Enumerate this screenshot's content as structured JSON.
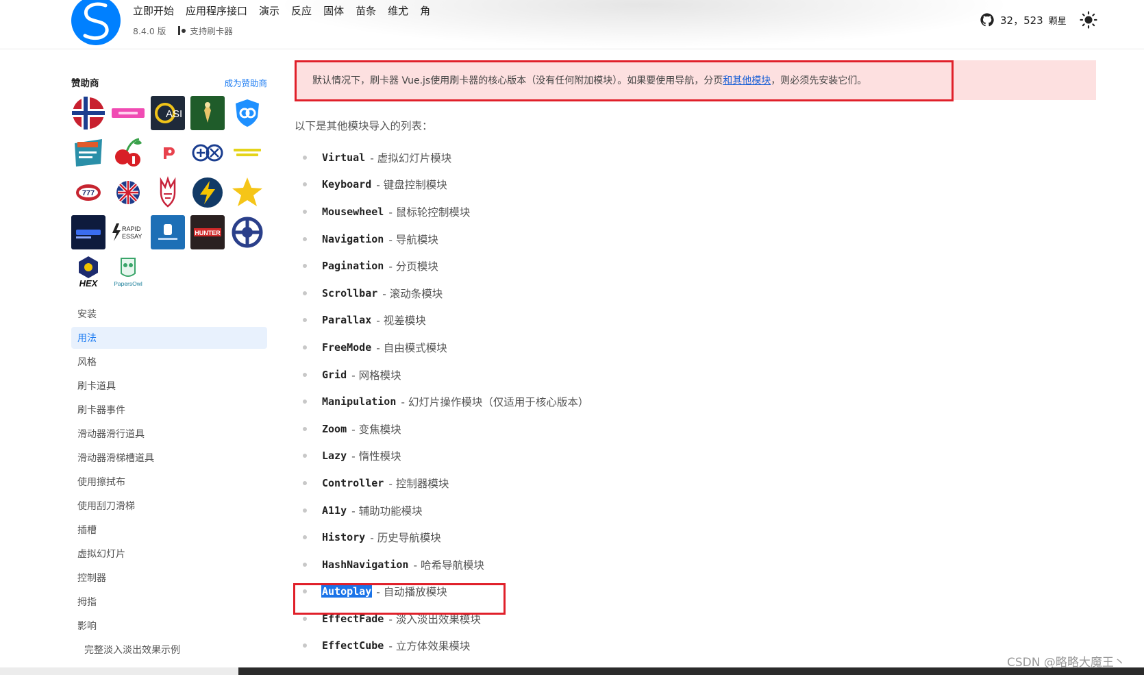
{
  "header": {
    "nav": [
      "立即开始",
      "应用程序接口",
      "演示",
      "反应",
      "固体",
      "苗条",
      "维尤",
      "角"
    ],
    "version": "8.4.0 版",
    "support_label": "支持刷卡器",
    "stars_count": "32，523",
    "stars_label": "颗星",
    "accent": "#0080ff"
  },
  "sidebar": {
    "sponsors_title": "赞助商",
    "become_sponsor": "成为赞助商",
    "sponsor_logos": {
      "casi": "ASI",
      "rapid_line1": "RAPID",
      "rapid_line2": "ESSAY",
      "hunter": "HUNTER",
      "hex": "HEX",
      "papersowl": "PapersOwl"
    },
    "menu": [
      "安装",
      "用法",
      "风格",
      "刷卡道具",
      "刷卡器事件",
      "滑动器滑行道具",
      "滑动器滑梯槽道具",
      "使用擦拭布",
      "使用刮刀滑梯",
      "插槽",
      "虚拟幻灯片",
      "控制器",
      "拇指",
      "影响"
    ],
    "submenu": [
      "完整淡入淡出效果示例"
    ],
    "active_index": 1
  },
  "content": {
    "note_before": "默认情况下，刷卡器 Vue.js使用刷卡器的核心版本（没有任何附加模块）。如果要使用导航，分页",
    "note_link": "和其他模块",
    "note_after": "，则必须先安装它们。",
    "intro": "以下是其他模块导入的列表：",
    "modules": [
      {
        "code": "Virtual",
        "desc": "- 虚拟幻灯片模块"
      },
      {
        "code": "Keyboard",
        "desc": "- 键盘控制模块"
      },
      {
        "code": "Mousewheel",
        "desc": "- 鼠标轮控制模块"
      },
      {
        "code": "Navigation",
        "desc": "- 导航模块"
      },
      {
        "code": "Pagination",
        "desc": "- 分页模块"
      },
      {
        "code": "Scrollbar",
        "desc": "- 滚动条模块"
      },
      {
        "code": "Parallax",
        "desc": "- 视差模块"
      },
      {
        "code": "FreeMode",
        "desc": "- 自由模式模块"
      },
      {
        "code": "Grid",
        "desc": "- 网格模块"
      },
      {
        "code": "Manipulation",
        "desc": "- 幻灯片操作模块（仅适用于核心版本）"
      },
      {
        "code": "Zoom",
        "desc": "- 变焦模块"
      },
      {
        "code": "Lazy",
        "desc": "- 惰性模块"
      },
      {
        "code": "Controller",
        "desc": "- 控制器模块"
      },
      {
        "code": "A11y",
        "desc": "- 辅助功能模块"
      },
      {
        "code": "History",
        "desc": "- 历史导航模块"
      },
      {
        "code": "HashNavigation",
        "desc": "- 哈希导航模块"
      },
      {
        "code": "Autoplay",
        "desc": "- 自动播放模块"
      },
      {
        "code": "EffectFade",
        "desc": "- 淡入淡出效果模块"
      },
      {
        "code": "EffectCube",
        "desc": "- 立方体效果模块"
      }
    ],
    "highlight_code": "Autoplay"
  },
  "watermark": "CSDN @略略大魔王丶"
}
